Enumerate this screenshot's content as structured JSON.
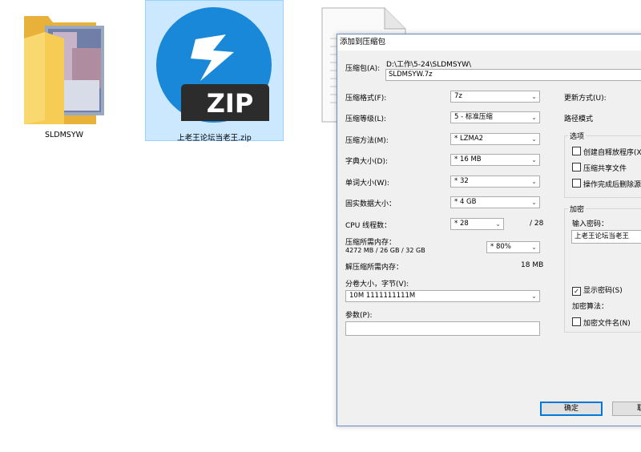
{
  "desktop": {
    "folder_name": "SLDMSYW",
    "zip_name": "上老王论坛当老王.zip",
    "zip_badge": "ZIP"
  },
  "dialog": {
    "title": "添加到压缩包",
    "archive_label": "压缩包(A):",
    "archive_path": "D:\\工作\\5-24\\SLDMSYW\\",
    "archive_name": "SLDMSYW.7z",
    "format_label": "压缩格式(F):",
    "format_value": "7z",
    "level_label": "压缩等级(L):",
    "level_value": "5 - 标准压缩",
    "method_label": "压缩方法(M):",
    "method_value": "* LZMA2",
    "dict_label": "字典大小(D):",
    "dict_value": "* 16 MB",
    "word_label": "单词大小(W):",
    "word_value": "* 32",
    "solid_label": "固实数据大小：",
    "solid_value": "* 4 GB",
    "cpu_label": "CPU 线程数：",
    "cpu_value": "* 28",
    "cpu_total": "/ 28",
    "mem_comp_label": "压缩所需内存：",
    "mem_comp_detail": "4272 MB / 26 GB / 32 GB",
    "mem_comp_value": "* 80%",
    "mem_decomp_label": "解压缩所需内存：",
    "mem_decomp_value": "18 MB",
    "volume_label": "分卷大小，字节(V):",
    "volume_value": "10M 1111111111M",
    "params_label": "参数(P):",
    "params_value": "",
    "update_label": "更新方式(U):",
    "path_mode_label": "路径模式",
    "options_title": "选项",
    "opt_sfx": "创建自释放程序(X",
    "opt_shared": "压缩共享文件",
    "opt_delete": "操作完成后删除源",
    "encrypt_title": "加密",
    "password_label": "输入密码：",
    "password_value": "上老王论坛当老王",
    "show_password": "显示密码(S)",
    "encrypt_method_label": "加密算法：",
    "encrypt_names": "加密文件名(N)",
    "ok_button": "确定",
    "cancel_button": "取"
  },
  "colors": {
    "zip_circle": "#1a88d8",
    "zip_badge_bg": "#2c2c2c",
    "selection": "#cce8ff",
    "folder": "#f5c645"
  }
}
